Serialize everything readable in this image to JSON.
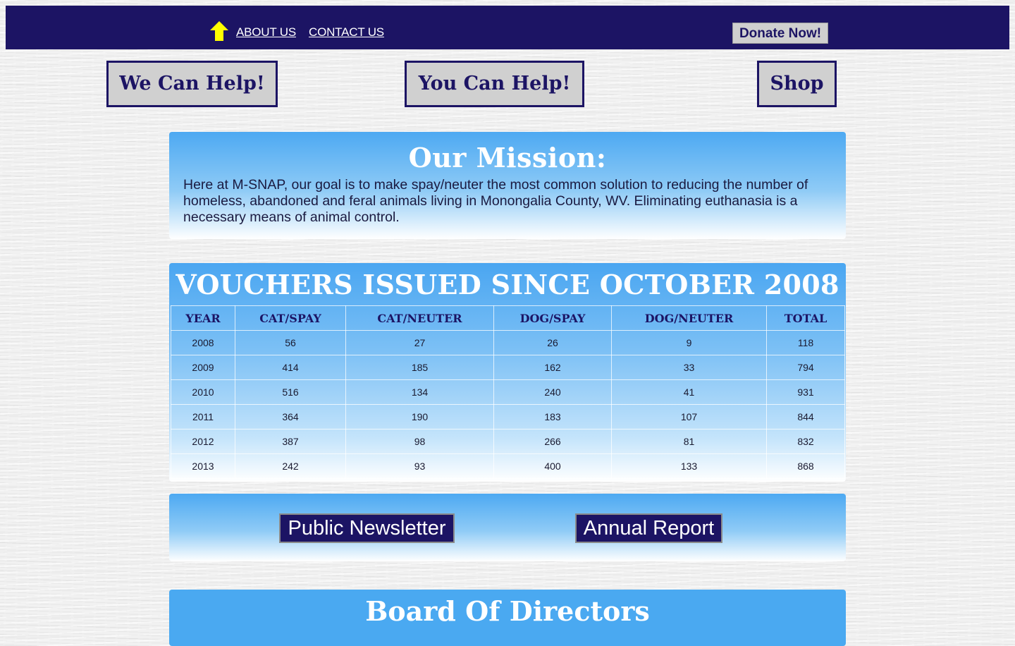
{
  "nav": {
    "home_icon": "up-arrow-home-icon",
    "about_label": "ABOUT US",
    "contact_label": "CONTACT US",
    "donate_label": "Donate Now!"
  },
  "buttons": {
    "we_can_help": "We Can Help!",
    "you_can_help": "You Can Help!",
    "shop": "Shop"
  },
  "mission": {
    "title": "Our Mission:",
    "text": "Here at M-SNAP, our goal is to make spay/neuter the most common solution to reducing the number of homeless, abandoned and feral animals living in Monongalia County, WV. Eliminating euthanasia is a necessary means of animal control."
  },
  "vouchers": {
    "title": "VOUCHERS ISSUED SINCE OCTOBER 2008",
    "columns": [
      "YEAR",
      "CAT/SPAY",
      "CAT/NEUTER",
      "DOG/SPAY",
      "DOG/NEUTER",
      "TOTAL"
    ],
    "rows": [
      [
        "2008",
        "56",
        "27",
        "26",
        "9",
        "118"
      ],
      [
        "2009",
        "414",
        "185",
        "162",
        "33",
        "794"
      ],
      [
        "2010",
        "516",
        "134",
        "240",
        "41",
        "931"
      ],
      [
        "2011",
        "364",
        "190",
        "183",
        "107",
        "844"
      ],
      [
        "2012",
        "387",
        "98",
        "266",
        "81",
        "832"
      ],
      [
        "2013",
        "242",
        "93",
        "400",
        "133",
        "868"
      ]
    ]
  },
  "reports": {
    "newsletter_label": "Public Newsletter",
    "annual_label": "Annual Report"
  },
  "board": {
    "title": "Board Of Directors"
  },
  "colors": {
    "navy": "#1c1464",
    "sky": "#4aa9f1",
    "arrow": "#ffff00"
  }
}
